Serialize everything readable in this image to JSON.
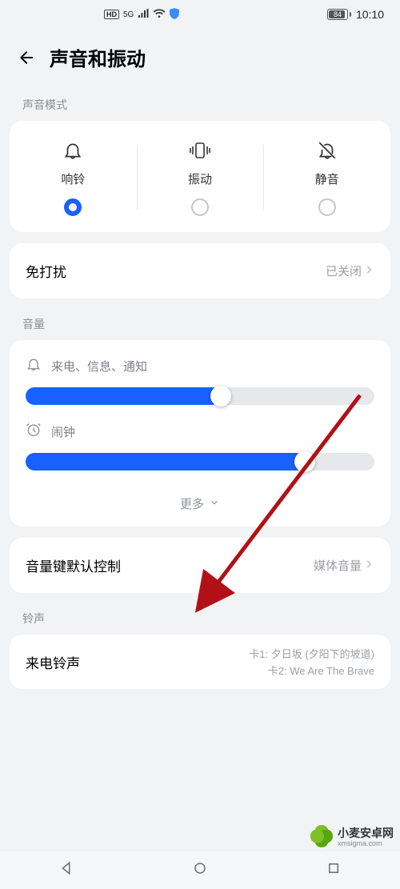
{
  "status": {
    "hd_badge": "HD",
    "network": "5G",
    "battery_pct": "84",
    "time": "10:10"
  },
  "header": {
    "title": "声音和振动"
  },
  "sections": {
    "sound_mode_label": "声音模式",
    "volume_label": "音量",
    "ringtone_label": "铃声"
  },
  "sound_modes": {
    "ring": "响铃",
    "vibrate": "振动",
    "mute": "静音",
    "selected": "ring"
  },
  "dnd": {
    "title": "免打扰",
    "value": "已关闭"
  },
  "volume": {
    "incoming": {
      "label": "来电、信息、通知",
      "pct": 56
    },
    "alarm": {
      "label": "闹钟",
      "pct": 80
    },
    "more": "更多"
  },
  "vol_key_ctrl": {
    "title": "音量键默认控制",
    "value": "媒体音量"
  },
  "ringtone": {
    "title": "来电铃声",
    "line1": "卡1: 夕日坂 (夕阳下的坡道)",
    "line2": "卡2: We Are The Brave"
  },
  "watermark": {
    "text": "小麦安卓网",
    "sub": "xmsigma.com"
  }
}
